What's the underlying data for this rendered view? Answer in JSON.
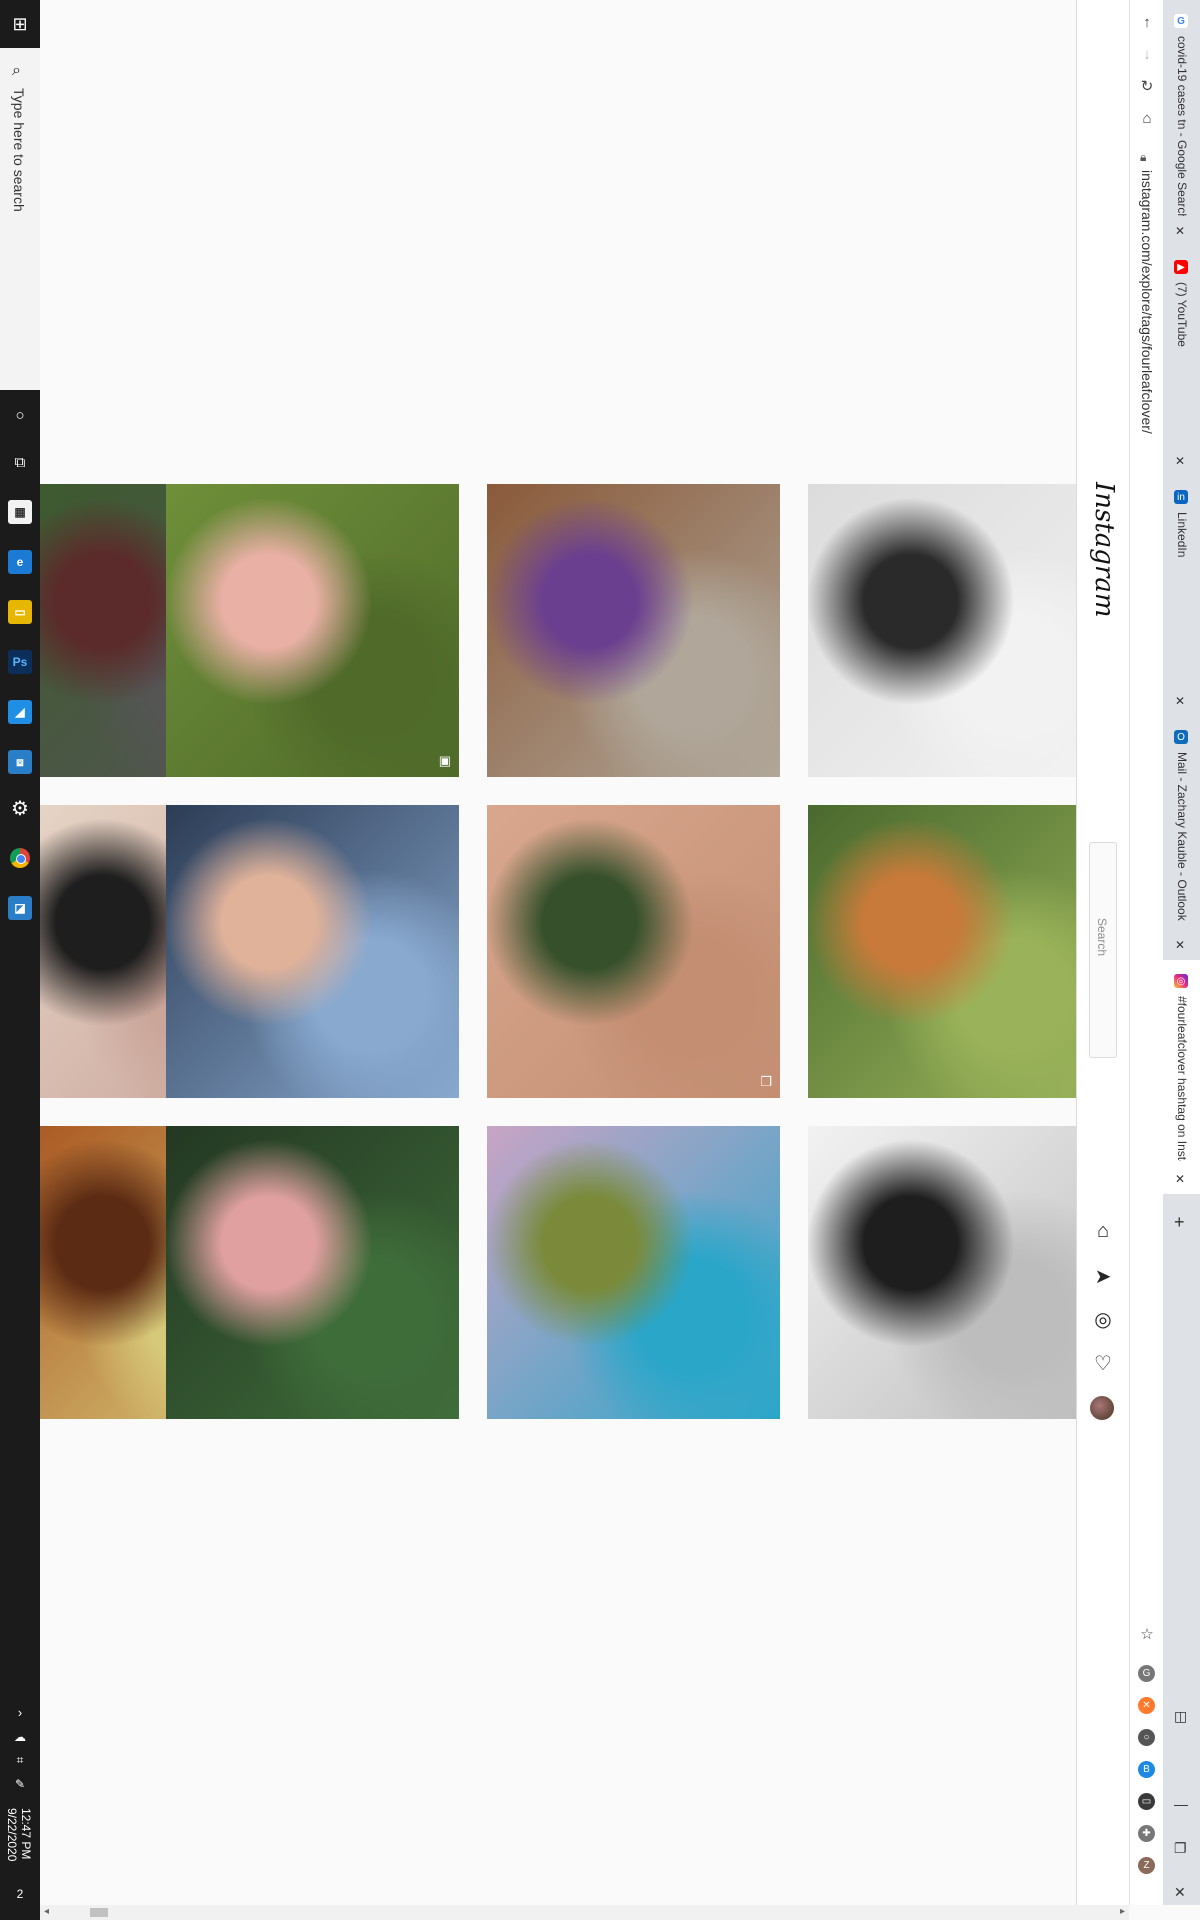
{
  "taskbar": {
    "search_placeholder": "Type here to search",
    "time": "12:47 PM",
    "date": "9/22/2020",
    "notification_count": "2"
  },
  "browser": {
    "url": "instagram.com/explore/tags/fourleafclover/",
    "tabs": [
      {
        "title": "covid-19 cases tn - Google Search",
        "favicon": "google-icon"
      },
      {
        "title": "(7) YouTube",
        "favicon": "youtube-icon"
      },
      {
        "title": "LinkedIn",
        "favicon": "linkedin-icon"
      },
      {
        "title": "Mail - Zachary Kauble - Outlook",
        "favicon": "outlook-icon"
      },
      {
        "title": "#fourleafclover hashtag on Instagram",
        "favicon": "instagram-icon",
        "active": true
      }
    ],
    "new_tab": "+"
  },
  "instagram": {
    "logo": "Instagram",
    "search_placeholder": "Search",
    "posts": [
      {
        "subject": "clover under glass",
        "colors": [
          "#3b5a2c",
          "#5b2a2a",
          "#555"
        ]
      },
      {
        "subject": "hand holding clover on grass",
        "colors": [
          "#6f8f3a",
          "#e9b0a5",
          "#4f6a29"
        ],
        "badge": "reel-icon"
      },
      {
        "subject": "spaniel dog by brick wall",
        "colors": [
          "#8a5a3a",
          "#6b3f8f",
          "#b0a79a"
        ]
      },
      {
        "subject": "clover necklace",
        "colors": [
          "#dcdcdc",
          "#2a2a2a",
          "#f2f2f2"
        ]
      },
      {
        "subject": "close-up skin",
        "colors": [
          "#e7d7c8",
          "#1e1e1e",
          "#caa59a"
        ]
      },
      {
        "subject": "girl filter with clovers",
        "colors": [
          "#2c3c55",
          "#e0b29a",
          "#89a9cf"
        ]
      },
      {
        "subject": "clover postcard",
        "colors": [
          "#d8a78e",
          "#35502b",
          "#c38e72"
        ],
        "badge": "carousel-icon"
      },
      {
        "subject": "fruit tree with card",
        "colors": [
          "#4a6a2e",
          "#c87a3a",
          "#9ab35a"
        ]
      },
      {
        "subject": "decorated plate",
        "colors": [
          "#a8531e",
          "#5c2b13",
          "#d7c97a"
        ],
        "badge": "carousel-icon"
      },
      {
        "subject": "fingers holding clover",
        "colors": [
          "#243823",
          "#e0a0a0",
          "#3f6d3a"
        ]
      },
      {
        "subject": "vintage brooches",
        "colors": [
          "#c9a4c5",
          "#7a8a3a",
          "#2aa6c9"
        ]
      },
      {
        "subject": "sketchbook drawing",
        "colors": [
          "#f2f2f2",
          "#1e1e1e",
          "#bdbdbd"
        ]
      }
    ]
  }
}
